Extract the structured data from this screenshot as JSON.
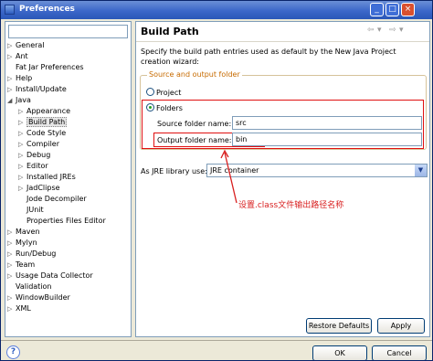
{
  "window": {
    "title": "Preferences"
  },
  "left": {
    "filter_value": "",
    "tree": [
      {
        "label": "General",
        "twisty": "▷",
        "indent": 0
      },
      {
        "label": "Ant",
        "twisty": "▷",
        "indent": 0
      },
      {
        "label": "Fat Jar Preferences",
        "twisty": "",
        "indent": 0
      },
      {
        "label": "Help",
        "twisty": "▷",
        "indent": 0
      },
      {
        "label": "Install/Update",
        "twisty": "▷",
        "indent": 0
      },
      {
        "label": "Java",
        "twisty": "◢",
        "indent": 0
      },
      {
        "label": "Appearance",
        "twisty": "▷",
        "indent": 1
      },
      {
        "label": "Build Path",
        "twisty": "▷",
        "indent": 1,
        "selected": true
      },
      {
        "label": "Code Style",
        "twisty": "▷",
        "indent": 1
      },
      {
        "label": "Compiler",
        "twisty": "▷",
        "indent": 1
      },
      {
        "label": "Debug",
        "twisty": "▷",
        "indent": 1
      },
      {
        "label": "Editor",
        "twisty": "▷",
        "indent": 1
      },
      {
        "label": "Installed JREs",
        "twisty": "▷",
        "indent": 1
      },
      {
        "label": "JadClipse",
        "twisty": "▷",
        "indent": 1
      },
      {
        "label": "Jode Decompiler",
        "twisty": "",
        "indent": 1
      },
      {
        "label": "JUnit",
        "twisty": "",
        "indent": 1
      },
      {
        "label": "Properties Files Editor",
        "twisty": "",
        "indent": 1
      },
      {
        "label": "Maven",
        "twisty": "▷",
        "indent": 0
      },
      {
        "label": "Mylyn",
        "twisty": "▷",
        "indent": 0
      },
      {
        "label": "Run/Debug",
        "twisty": "▷",
        "indent": 0
      },
      {
        "label": "Team",
        "twisty": "▷",
        "indent": 0
      },
      {
        "label": "Usage Data Collector",
        "twisty": "▷",
        "indent": 0
      },
      {
        "label": "Validation",
        "twisty": "",
        "indent": 0
      },
      {
        "label": "WindowBuilder",
        "twisty": "▷",
        "indent": 0
      },
      {
        "label": "XML",
        "twisty": "▷",
        "indent": 0
      }
    ]
  },
  "page": {
    "title": "Build Path",
    "nav_back": "⇦",
    "nav_forward": "⇨",
    "nav_menu": "▾",
    "description": "Specify the build path entries used as default by the New Java Project creation wizard:",
    "group_label": "Source and output folder",
    "radio_project": "Project",
    "radio_folders": "Folders",
    "source_label": "Source folder name:",
    "source_value": "src",
    "output_label": "Output folder name:",
    "output_value": "bin",
    "jre_label": "As JRE library use:",
    "jre_value": "JRE container",
    "annotation": "设置.class文件输出路径名称",
    "restore_defaults": "Restore Defaults",
    "apply": "Apply"
  },
  "footer": {
    "ok": "OK",
    "cancel": "Cancel",
    "help_symbol": "?"
  },
  "colors": {
    "annotation": "#d81e1e",
    "group_label": "#c76b00",
    "title_bar": "#3c67c9"
  },
  "icons": [
    "back-icon",
    "forward-icon",
    "menu-dropdown-icon",
    "help-icon",
    "minimize-icon",
    "maximize-icon",
    "close-icon"
  ]
}
